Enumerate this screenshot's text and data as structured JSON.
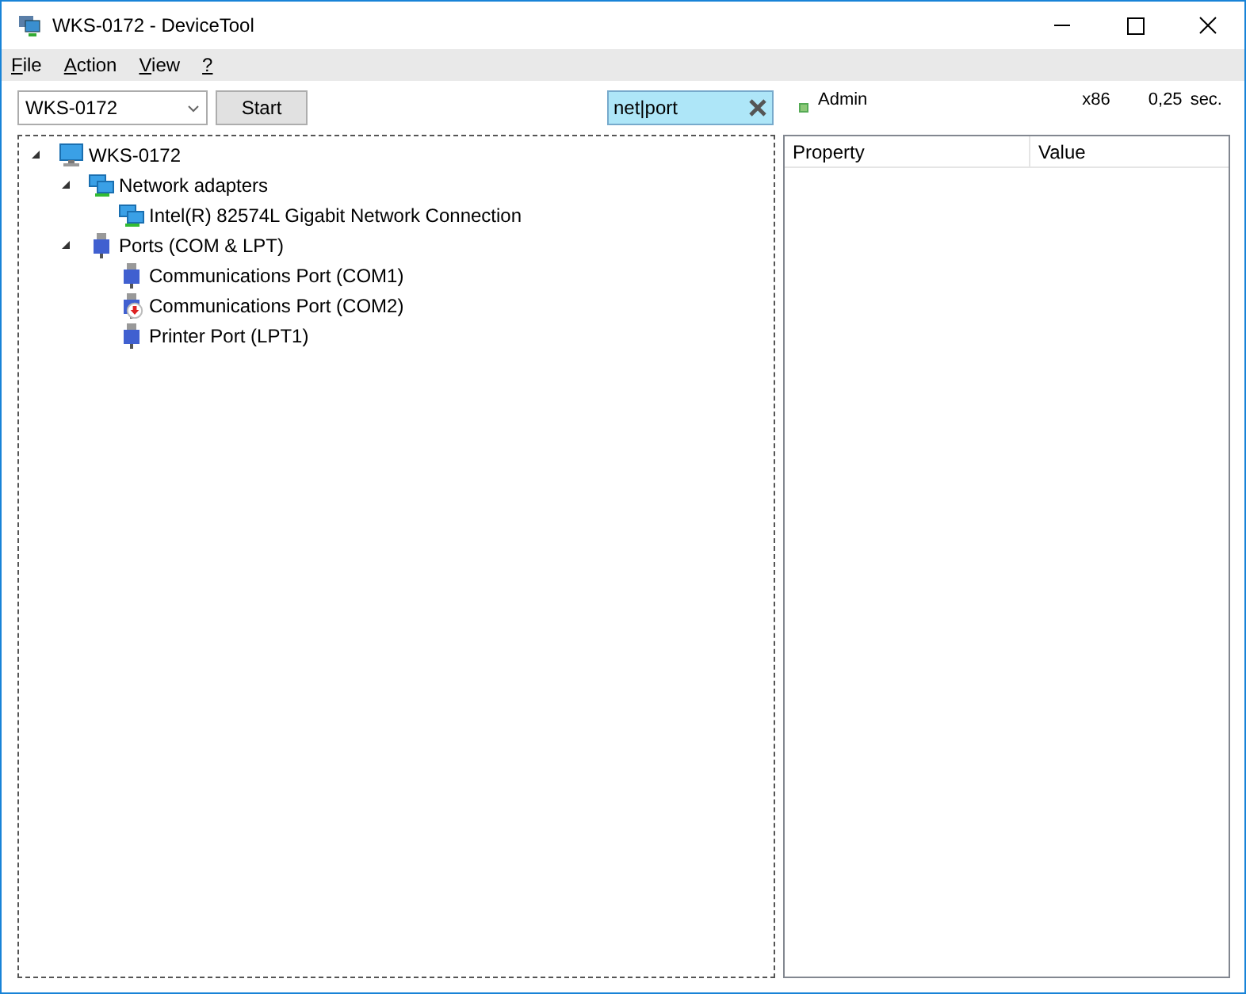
{
  "window": {
    "title": "WKS-0172 - DeviceTool"
  },
  "menu": [
    "File",
    "Action",
    "View",
    "?"
  ],
  "toolbar": {
    "computer": "WKS-0172",
    "start_button": "Start",
    "search": {
      "value": "net|port"
    }
  },
  "status": {
    "user": {
      "label": "Admin",
      "color": "#8cc878"
    },
    "arch": "x86",
    "time": "0,25",
    "time_unit": "sec."
  },
  "tree": [
    {
      "label": "WKS-0172",
      "kind": "computer",
      "expanded": true,
      "children": [
        {
          "label": "Network adapters",
          "kind": "network",
          "expanded": true,
          "children": [
            {
              "label": "Intel(R) 82574L Gigabit Network Connection",
              "kind": "network",
              "disabled": false
            }
          ]
        },
        {
          "label": "Ports (COM & LPT)",
          "kind": "port",
          "expanded": true,
          "children": [
            {
              "label": "Communications Port (COM1)",
              "kind": "port",
              "disabled": false
            },
            {
              "label": "Communications Port (COM2)",
              "kind": "port",
              "disabled": true
            },
            {
              "label": "Printer Port (LPT1)",
              "kind": "port",
              "disabled": false
            }
          ]
        }
      ]
    }
  ],
  "properties": {
    "columns": [
      "Property",
      "Value"
    ]
  }
}
